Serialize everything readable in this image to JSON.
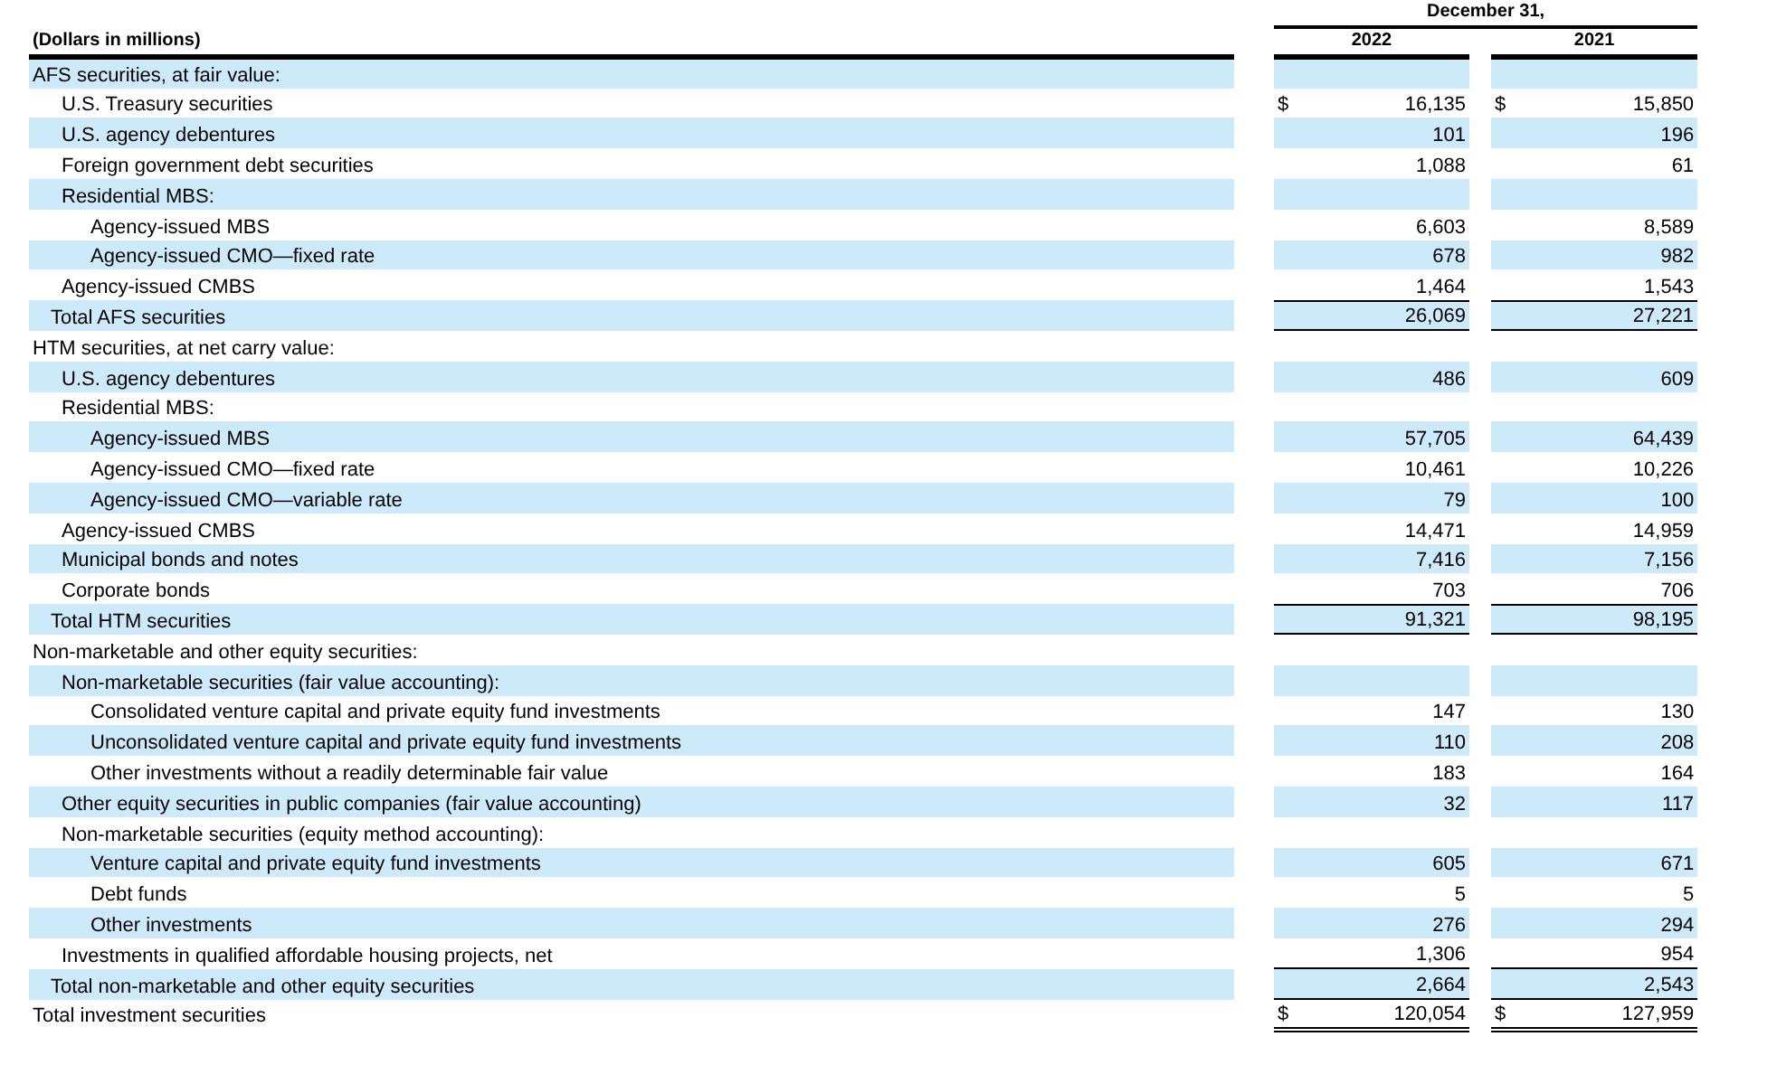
{
  "table": {
    "units_label": "(Dollars in millions)",
    "period_header": "December 31,",
    "columns": [
      "2022",
      "2021"
    ],
    "rows": [
      {
        "kind": "header",
        "label": "AFS securities, at fair value:",
        "children": [
          {
            "kind": "item",
            "label": "U.S. Treasury securities",
            "currency": "$",
            "values": [
              "16,135",
              "15,850"
            ]
          },
          {
            "kind": "item",
            "label": "U.S. agency debentures",
            "values": [
              "101",
              "196"
            ]
          },
          {
            "kind": "item",
            "label": "Foreign government debt securities",
            "values": [
              "1,088",
              "61"
            ]
          },
          {
            "kind": "header",
            "label": "Residential MBS:",
            "children": [
              {
                "kind": "item",
                "label": "Agency-issued MBS",
                "values": [
                  "6,603",
                  "8,589"
                ]
              },
              {
                "kind": "item",
                "label": "Agency-issued CMO—fixed rate",
                "values": [
                  "678",
                  "982"
                ]
              }
            ]
          },
          {
            "kind": "item",
            "label": "Agency-issued CMBS",
            "values": [
              "1,464",
              "1,543"
            ]
          }
        ]
      },
      {
        "kind": "total",
        "label": "Total AFS securities",
        "values": [
          "26,069",
          "27,221"
        ]
      },
      {
        "kind": "header",
        "label": "HTM securities, at net carry value:",
        "children": [
          {
            "kind": "item",
            "label": "U.S. agency debentures",
            "values": [
              "486",
              "609"
            ]
          },
          {
            "kind": "header",
            "label": "Residential MBS:",
            "children": [
              {
                "kind": "item",
                "label": "Agency-issued MBS",
                "values": [
                  "57,705",
                  "64,439"
                ]
              },
              {
                "kind": "item",
                "label": "Agency-issued CMO—fixed rate",
                "values": [
                  "10,461",
                  "10,226"
                ]
              },
              {
                "kind": "item",
                "label": "Agency-issued CMO—variable rate",
                "values": [
                  "79",
                  "100"
                ]
              }
            ]
          },
          {
            "kind": "item",
            "label": "Agency-issued CMBS",
            "values": [
              "14,471",
              "14,959"
            ]
          },
          {
            "kind": "item",
            "label": "Municipal bonds and notes",
            "values": [
              "7,416",
              "7,156"
            ]
          },
          {
            "kind": "item",
            "label": "Corporate bonds",
            "values": [
              "703",
              "706"
            ]
          }
        ]
      },
      {
        "kind": "total",
        "label": "Total HTM securities",
        "values": [
          "91,321",
          "98,195"
        ]
      },
      {
        "kind": "header",
        "label": "Non-marketable and other equity securities:",
        "children": [
          {
            "kind": "header",
            "label": "Non-marketable securities (fair value accounting):",
            "children": [
              {
                "kind": "item",
                "label": "Consolidated venture capital and private equity fund investments",
                "values": [
                  "147",
                  "130"
                ]
              },
              {
                "kind": "item",
                "label": "Unconsolidated venture capital and private equity fund investments",
                "values": [
                  "110",
                  "208"
                ]
              },
              {
                "kind": "item",
                "label": "Other investments without a readily determinable fair value",
                "values": [
                  "183",
                  "164"
                ]
              }
            ]
          },
          {
            "kind": "item",
            "label": "Other equity securities in public companies (fair value accounting)",
            "values": [
              "32",
              "117"
            ]
          },
          {
            "kind": "header",
            "label": "Non-marketable securities (equity method accounting):",
            "children": [
              {
                "kind": "item",
                "label": "Venture capital and private equity fund investments",
                "values": [
                  "605",
                  "671"
                ]
              },
              {
                "kind": "item",
                "label": "Debt funds",
                "values": [
                  "5",
                  "5"
                ]
              },
              {
                "kind": "item",
                "label": "Other investments",
                "values": [
                  "276",
                  "294"
                ]
              }
            ]
          },
          {
            "kind": "item",
            "label": "Investments in qualified affordable housing projects, net",
            "values": [
              "1,306",
              "954"
            ]
          }
        ]
      },
      {
        "kind": "total",
        "label": "Total non-marketable and other equity securities",
        "values": [
          "2,664",
          "2,543"
        ]
      },
      {
        "kind": "grand_total",
        "label": "Total investment securities",
        "currency": "$",
        "values": [
          "120,054",
          "127,959"
        ]
      }
    ]
  }
}
